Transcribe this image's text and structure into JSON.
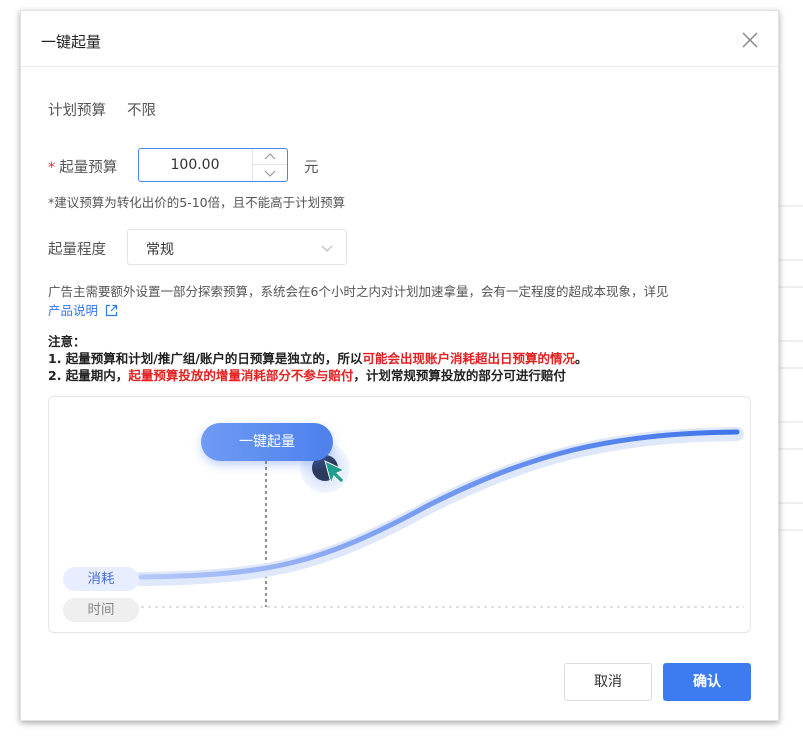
{
  "dialog": {
    "title": "一键起量",
    "plan_budget_label": "计划预算",
    "plan_budget_value": "不限",
    "boost_budget_label": "起量预算",
    "boost_budget_value": "100.00",
    "unit": "元",
    "hint": "*建议预算为转化出价的5-10倍，且不能高于计划预算",
    "level_label": "起量程度",
    "level_value": "常规",
    "description": "广告主需要额外设置一部分探索预算，系统会在6个小时之内对计划加速拿量，会有一定程度的超成本现象，详见",
    "description_link": "产品说明",
    "notes_title": "注意：",
    "note1_prefix": "1. 起量预算和计划/推广组/账户的日预算是独立的，所以",
    "note1_red": "可能会出现账户消耗超出日预算的情况",
    "note1_suffix": "。",
    "note2_prefix": "2. 起量期内，",
    "note2_red": "起量预算投放的增量消耗部分不参与赔付",
    "note2_suffix": "，计划常规预算投放的部分可进行赔付",
    "illustration": {
      "button_label": "一键起量",
      "cost_label": "消耗",
      "time_label": "时间"
    },
    "cancel_label": "取消",
    "confirm_label": "确认"
  },
  "colors": {
    "primary": "#3d7cf0",
    "warning_red": "#e62020",
    "required_star": "#e5322e"
  },
  "icons": [
    "close-icon",
    "chevron-up-icon",
    "chevron-down-icon",
    "external-link-icon",
    "cursor-icon"
  ]
}
